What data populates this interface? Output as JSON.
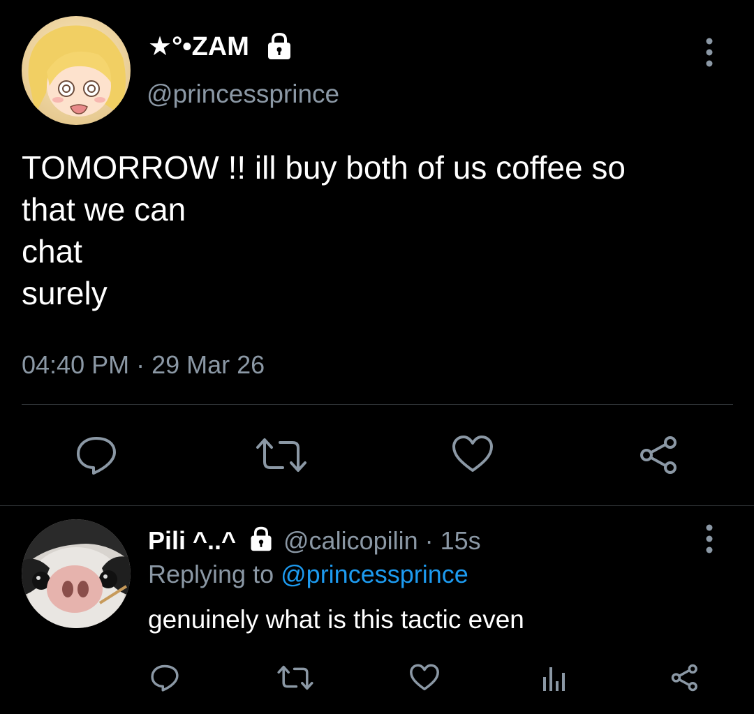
{
  "main_tweet": {
    "display_name": "★°•ZAM",
    "handle": "@princessprince",
    "text": "TOMORROW !! ill buy both of us coffee so\nthat we can\nchat\nsurely",
    "timestamp": "04:40 PM · 29 Mar 26",
    "avatar_icon": "anime-girl-avatar",
    "actions": [
      "reply-icon",
      "retweet-icon",
      "like-icon",
      "share-icon"
    ]
  },
  "reply_tweet": {
    "display_name": "Pili ^..^",
    "handle_time": "@calicopilin · 15s",
    "replying_prefix": "Replying to",
    "replying_handle": "@princessprince",
    "text": "genuinely what is this tactic even",
    "avatar_icon": "cat-avatar",
    "actions": [
      "reply-icon",
      "retweet-icon",
      "like-icon",
      "stats-icon",
      "share-icon"
    ]
  },
  "colors": {
    "background": "#000000",
    "primary_text": "#ffffff",
    "secondary_text": "#8b98a5",
    "link": "#1d9bf0",
    "divider": "#2f3336",
    "icon": "#8b98a5"
  }
}
